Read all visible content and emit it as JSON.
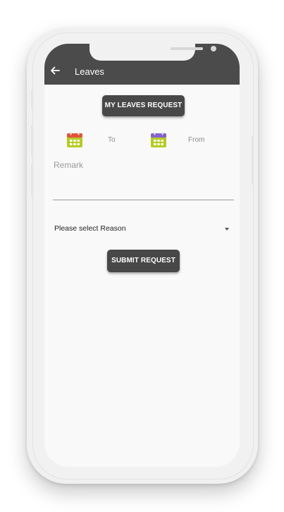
{
  "appbar": {
    "title": "Leaves",
    "back_icon": "arrow-left-icon"
  },
  "buttons": {
    "my_leaves": "MY LEAVES REQUEST",
    "submit": "SUBMIT REQUEST"
  },
  "date_range": {
    "to_label": "To",
    "from_label": "From",
    "to_icon": "calendar-icon",
    "from_icon": "calendar-icon",
    "to_icon_header_color": "#e2523b",
    "from_icon_header_color": "#8561cf",
    "icon_body_color": "#b5cb23"
  },
  "remark": {
    "placeholder": "Remark",
    "value": ""
  },
  "reason": {
    "selected": "Please select Reason",
    "dropdown_icon": "caret-down-icon"
  },
  "colors": {
    "appbar": "#4b4b4b",
    "button": "#484848",
    "screen_bg": "#f9f9f9"
  }
}
